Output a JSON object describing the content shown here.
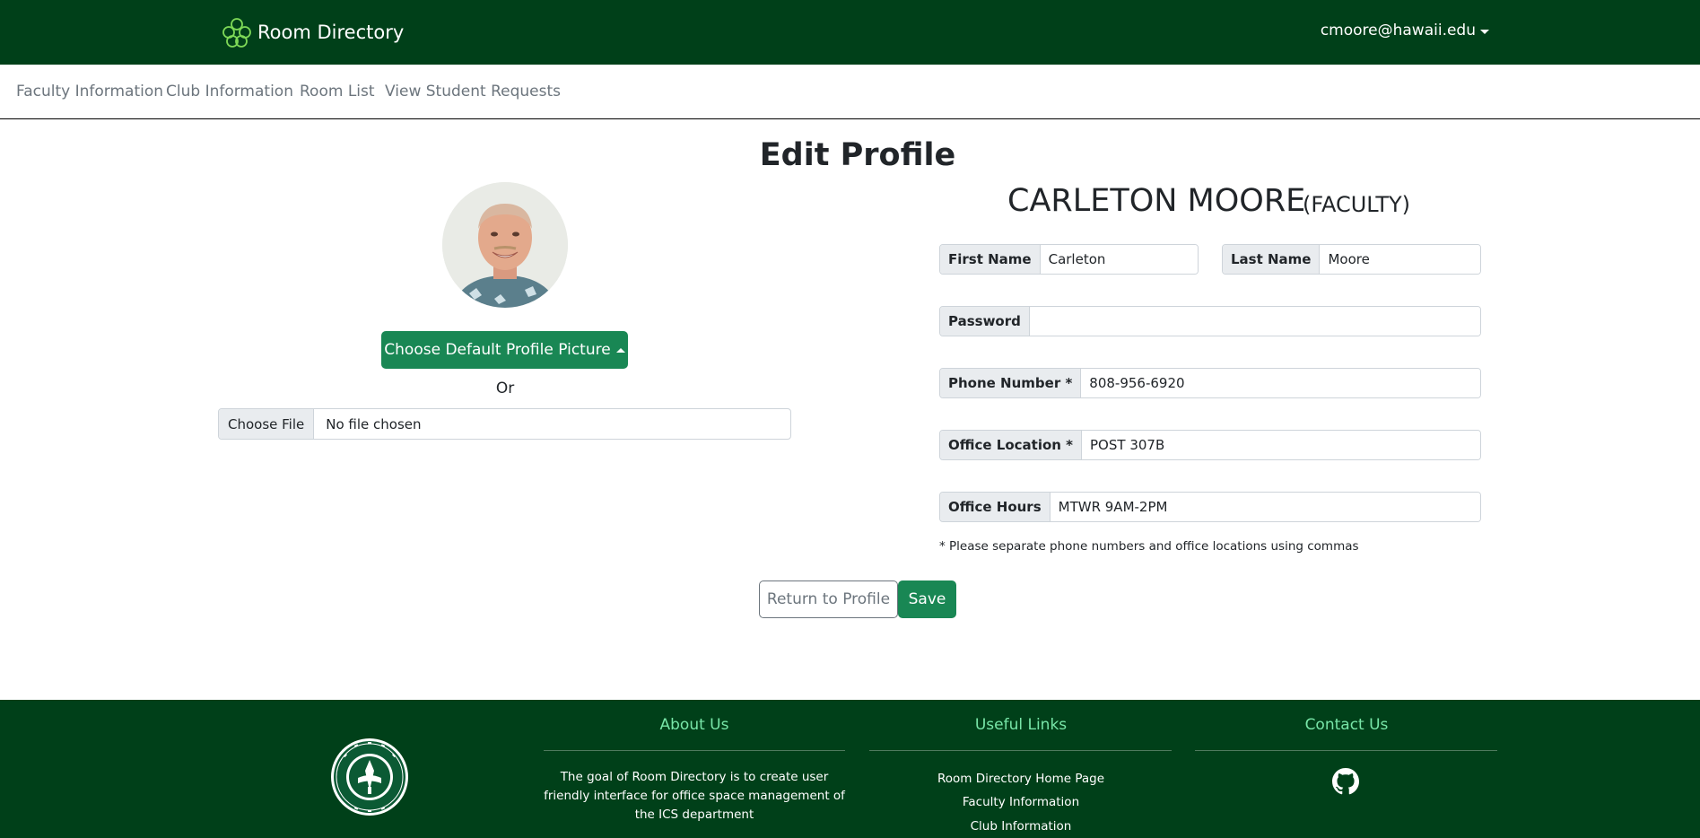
{
  "header": {
    "brand": "Room Directory",
    "user_email": "cmoore@hawaii.edu"
  },
  "subnav": {
    "items": [
      "Faculty Information",
      "Club Information",
      "Room List",
      "View Student Requests"
    ]
  },
  "page": {
    "title": "Edit Profile"
  },
  "profile": {
    "name": "CARLETON MOORE",
    "role": "(FACULTY)",
    "default_picture_button": "Choose Default Profile Picture",
    "or_text": "Or",
    "file_button": "Choose File",
    "file_status": "No file chosen"
  },
  "form": {
    "first_name_label": "First Name",
    "first_name": "Carleton",
    "last_name_label": "Last Name",
    "last_name": "Moore",
    "password_label": "Password",
    "password": "",
    "phone_label": "Phone Number *",
    "phone": "808-956-6920",
    "office_location_label": "Office Location *",
    "office_location": "POST 307B",
    "office_hours_label": "Office Hours",
    "office_hours": "MTWR 9AM-2PM",
    "note": "* Please separate phone numbers and office locations using commas",
    "return_button": "Return to Profile",
    "save_button": "Save"
  },
  "footer": {
    "about_title": "About Us",
    "about_text": "The goal of Room Directory is to create user friendly interface for office space management of the ICS department",
    "links_title": "Useful Links",
    "links": [
      "Room Directory Home Page",
      "Faculty Information",
      "Club Information"
    ],
    "contact_title": "Contact Us",
    "contact_icon": "github-icon",
    "seal_icon": "university-seal"
  },
  "colors": {
    "header_bg": "#004019",
    "primary_green": "#198754",
    "footer_heading": "#78e6a8",
    "muted_text": "#6c757d"
  }
}
